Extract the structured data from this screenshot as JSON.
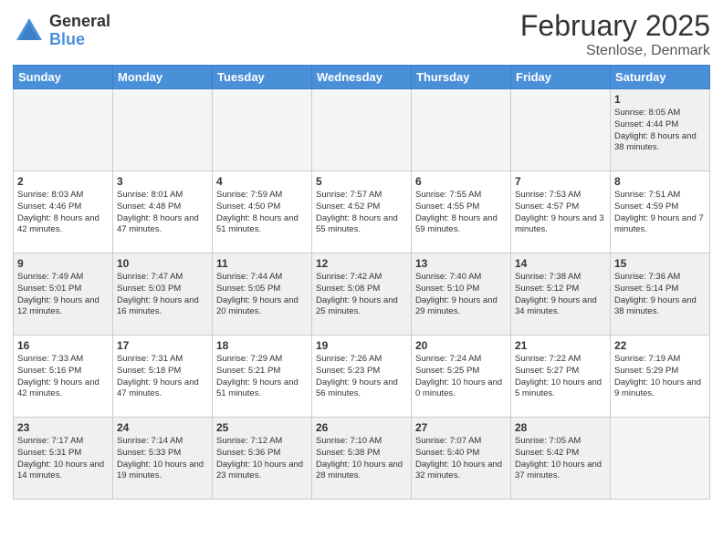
{
  "header": {
    "logo_general": "General",
    "logo_blue": "Blue",
    "month_year": "February 2025",
    "location": "Stenlose, Denmark"
  },
  "weekdays": [
    "Sunday",
    "Monday",
    "Tuesday",
    "Wednesday",
    "Thursday",
    "Friday",
    "Saturday"
  ],
  "weeks": [
    [
      {
        "day": "",
        "info": "",
        "empty": true
      },
      {
        "day": "",
        "info": "",
        "empty": true
      },
      {
        "day": "",
        "info": "",
        "empty": true
      },
      {
        "day": "",
        "info": "",
        "empty": true
      },
      {
        "day": "",
        "info": "",
        "empty": true
      },
      {
        "day": "",
        "info": "",
        "empty": true
      },
      {
        "day": "1",
        "info": "Sunrise: 8:05 AM\nSunset: 4:44 PM\nDaylight: 8 hours\nand 38 minutes."
      }
    ],
    [
      {
        "day": "2",
        "info": "Sunrise: 8:03 AM\nSunset: 4:46 PM\nDaylight: 8 hours\nand 42 minutes."
      },
      {
        "day": "3",
        "info": "Sunrise: 8:01 AM\nSunset: 4:48 PM\nDaylight: 8 hours\nand 47 minutes."
      },
      {
        "day": "4",
        "info": "Sunrise: 7:59 AM\nSunset: 4:50 PM\nDaylight: 8 hours\nand 51 minutes."
      },
      {
        "day": "5",
        "info": "Sunrise: 7:57 AM\nSunset: 4:52 PM\nDaylight: 8 hours\nand 55 minutes."
      },
      {
        "day": "6",
        "info": "Sunrise: 7:55 AM\nSunset: 4:55 PM\nDaylight: 8 hours\nand 59 minutes."
      },
      {
        "day": "7",
        "info": "Sunrise: 7:53 AM\nSunset: 4:57 PM\nDaylight: 9 hours\nand 3 minutes."
      },
      {
        "day": "8",
        "info": "Sunrise: 7:51 AM\nSunset: 4:59 PM\nDaylight: 9 hours\nand 7 minutes."
      }
    ],
    [
      {
        "day": "9",
        "info": "Sunrise: 7:49 AM\nSunset: 5:01 PM\nDaylight: 9 hours\nand 12 minutes."
      },
      {
        "day": "10",
        "info": "Sunrise: 7:47 AM\nSunset: 5:03 PM\nDaylight: 9 hours\nand 16 minutes."
      },
      {
        "day": "11",
        "info": "Sunrise: 7:44 AM\nSunset: 5:05 PM\nDaylight: 9 hours\nand 20 minutes."
      },
      {
        "day": "12",
        "info": "Sunrise: 7:42 AM\nSunset: 5:08 PM\nDaylight: 9 hours\nand 25 minutes."
      },
      {
        "day": "13",
        "info": "Sunrise: 7:40 AM\nSunset: 5:10 PM\nDaylight: 9 hours\nand 29 minutes."
      },
      {
        "day": "14",
        "info": "Sunrise: 7:38 AM\nSunset: 5:12 PM\nDaylight: 9 hours\nand 34 minutes."
      },
      {
        "day": "15",
        "info": "Sunrise: 7:36 AM\nSunset: 5:14 PM\nDaylight: 9 hours\nand 38 minutes."
      }
    ],
    [
      {
        "day": "16",
        "info": "Sunrise: 7:33 AM\nSunset: 5:16 PM\nDaylight: 9 hours\nand 42 minutes."
      },
      {
        "day": "17",
        "info": "Sunrise: 7:31 AM\nSunset: 5:18 PM\nDaylight: 9 hours\nand 47 minutes."
      },
      {
        "day": "18",
        "info": "Sunrise: 7:29 AM\nSunset: 5:21 PM\nDaylight: 9 hours\nand 51 minutes."
      },
      {
        "day": "19",
        "info": "Sunrise: 7:26 AM\nSunset: 5:23 PM\nDaylight: 9 hours\nand 56 minutes."
      },
      {
        "day": "20",
        "info": "Sunrise: 7:24 AM\nSunset: 5:25 PM\nDaylight: 10 hours\nand 0 minutes."
      },
      {
        "day": "21",
        "info": "Sunrise: 7:22 AM\nSunset: 5:27 PM\nDaylight: 10 hours\nand 5 minutes."
      },
      {
        "day": "22",
        "info": "Sunrise: 7:19 AM\nSunset: 5:29 PM\nDaylight: 10 hours\nand 9 minutes."
      }
    ],
    [
      {
        "day": "23",
        "info": "Sunrise: 7:17 AM\nSunset: 5:31 PM\nDaylight: 10 hours\nand 14 minutes."
      },
      {
        "day": "24",
        "info": "Sunrise: 7:14 AM\nSunset: 5:33 PM\nDaylight: 10 hours\nand 19 minutes."
      },
      {
        "day": "25",
        "info": "Sunrise: 7:12 AM\nSunset: 5:36 PM\nDaylight: 10 hours\nand 23 minutes."
      },
      {
        "day": "26",
        "info": "Sunrise: 7:10 AM\nSunset: 5:38 PM\nDaylight: 10 hours\nand 28 minutes."
      },
      {
        "day": "27",
        "info": "Sunrise: 7:07 AM\nSunset: 5:40 PM\nDaylight: 10 hours\nand 32 minutes."
      },
      {
        "day": "28",
        "info": "Sunrise: 7:05 AM\nSunset: 5:42 PM\nDaylight: 10 hours\nand 37 minutes."
      },
      {
        "day": "",
        "info": "",
        "empty": true
      }
    ]
  ]
}
